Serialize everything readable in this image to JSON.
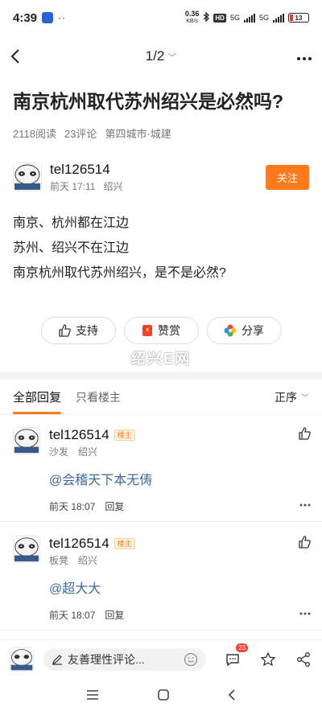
{
  "status_bar": {
    "time": "4:39",
    "dots": "··",
    "speed_value": "0.36",
    "speed_unit": "KB/s",
    "hd": "HD",
    "net1": "5G",
    "net2": "5G",
    "battery": "13"
  },
  "nav": {
    "page_indicator": "1/2"
  },
  "post": {
    "title": "南京杭州取代苏州绍兴是必然吗?",
    "reads": "2118阅读",
    "comments": "23评论",
    "category": "第四城市·城建",
    "author": {
      "name": "tel126514",
      "time": "前天 17:11",
      "location": "绍兴",
      "follow_label": "关注"
    },
    "content": [
      "南京、杭州都在江边",
      "苏州、绍兴不在江边",
      "南京杭州取代苏州绍兴，是不是必然?"
    ]
  },
  "actions": {
    "support": "支持",
    "reward": "赞赏",
    "share": "分享"
  },
  "watermark": "绍兴E网",
  "filter": {
    "all_replies": "全部回复",
    "owner_only": "只看楼主",
    "sort": "正序"
  },
  "comments": [
    {
      "name": "tel126514",
      "badge": "楼主",
      "floor": "沙发",
      "location": "绍兴",
      "text": "@会稽天下本无俦",
      "time": "前天 18:07",
      "reply": "回复"
    },
    {
      "name": "tel126514",
      "badge": "楼主",
      "floor": "板凳",
      "location": "绍兴",
      "text": "@超大大",
      "time": "前天 18:07",
      "reply": "回复"
    }
  ],
  "bottom": {
    "input_placeholder": "友善理性评论...",
    "comment_count": "23"
  },
  "colors": {
    "accent": "#ff7a1a",
    "mention": "#3a6aa0",
    "badge_red": "#f44336"
  }
}
